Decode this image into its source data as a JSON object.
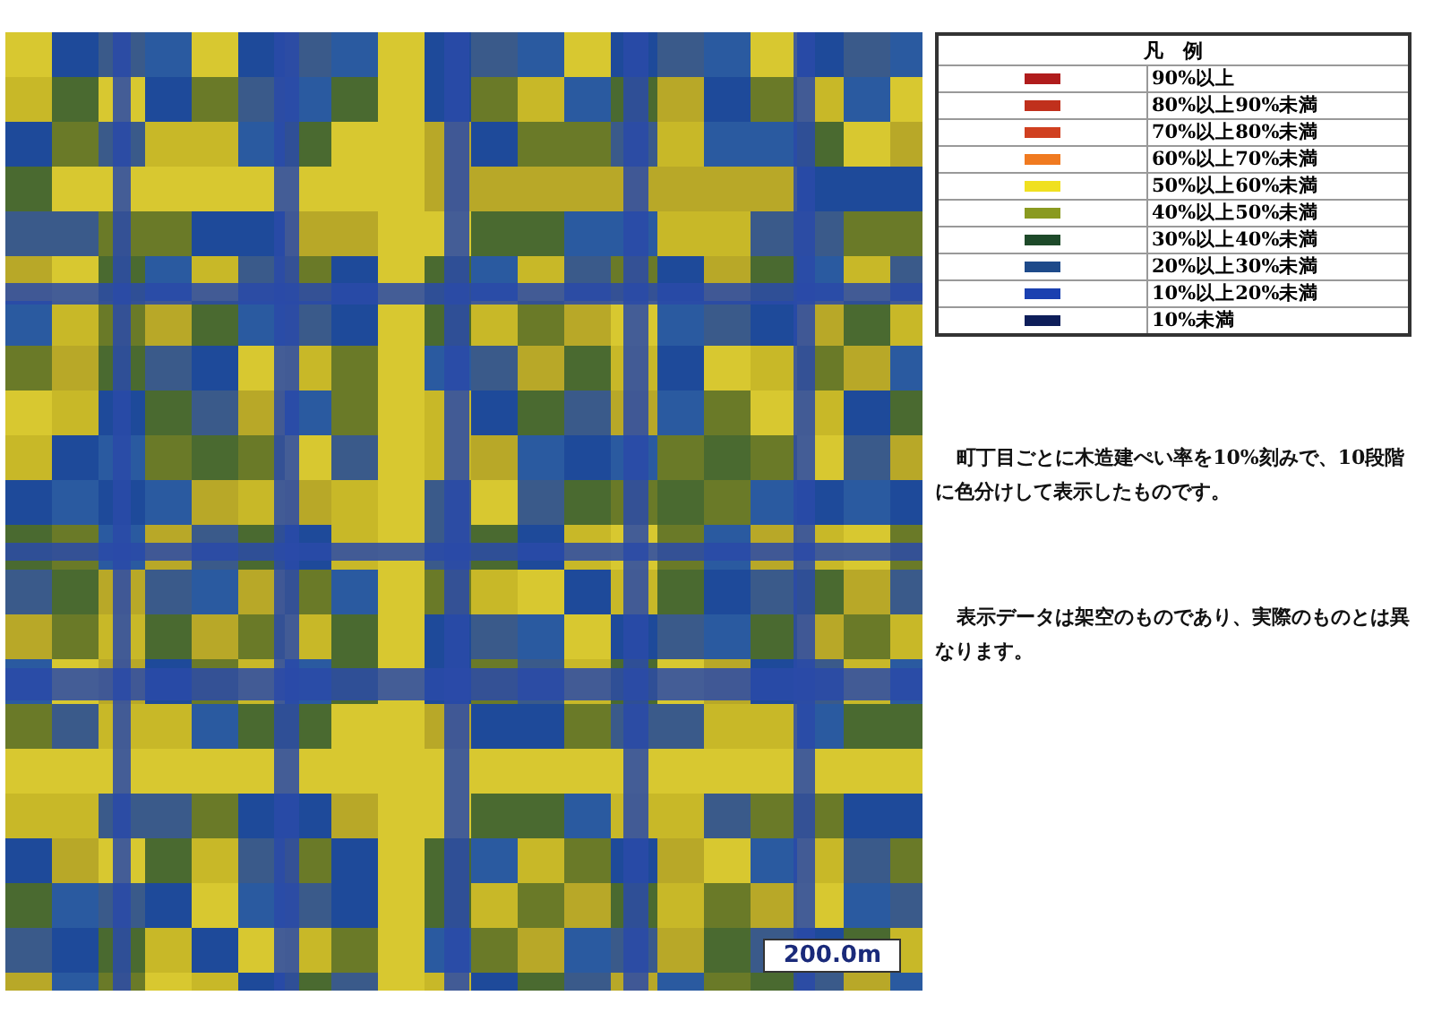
{
  "map": {
    "scale_label": "200.0m"
  },
  "legend": {
    "title": "凡　例",
    "items": [
      {
        "color": "#b01c1c",
        "label": "90%以上"
      },
      {
        "color": "#c0301c",
        "label": "80%以上90%未満"
      },
      {
        "color": "#d04020",
        "label": "70%以上80%未満"
      },
      {
        "color": "#f07a20",
        "label": "60%以上70%未満"
      },
      {
        "color": "#f0e020",
        "label": "50%以上60%未満"
      },
      {
        "color": "#8a9a20",
        "label": "40%以上50%未満"
      },
      {
        "color": "#1e4a2a",
        "label": "30%以上40%未満"
      },
      {
        "color": "#1e4a8a",
        "label": "20%以上30%未満"
      },
      {
        "color": "#1a40b0",
        "label": "10%以上20%未満"
      },
      {
        "color": "#0e1e5a",
        "label": "10%未満"
      }
    ]
  },
  "notes": [
    "町丁目ごとに木造建ぺい率を10%刻みで、10段階に色分けして表示したものです。",
    "表示データは架空のものであり、実際のものとは異なります。"
  ]
}
